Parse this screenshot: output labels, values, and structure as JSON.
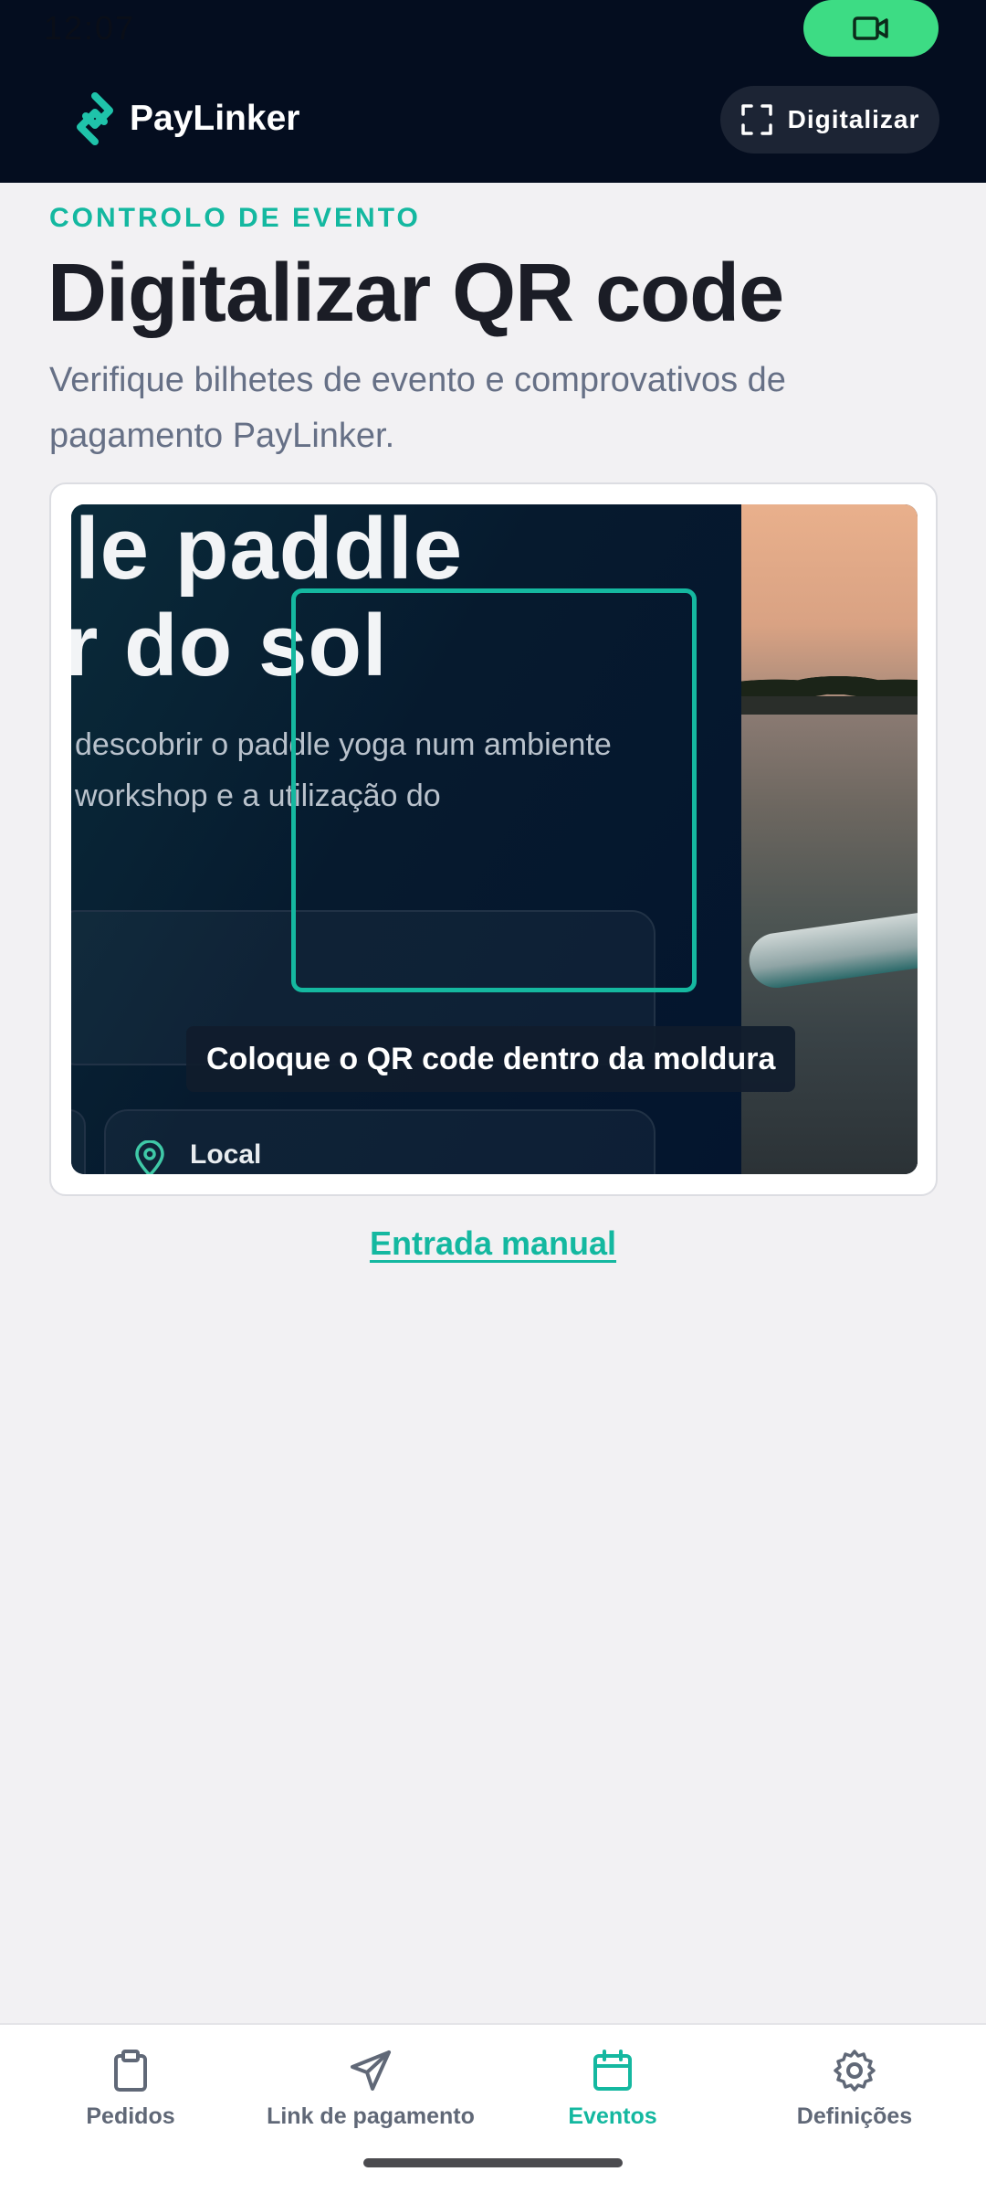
{
  "status_bar": {
    "time": "12:07"
  },
  "header": {
    "brand_name": "PayLinker",
    "scan_button_label": "Digitalizar"
  },
  "page": {
    "eyebrow": "CONTROLO DE EVENTO",
    "title": "Digitalizar QR code",
    "subtitle": "Verifique bilhetes de evento e comprovativos de pagamento PayLinker."
  },
  "scanner": {
    "camera_feed": {
      "headline_line1": "le paddle",
      "headline_line2": "r do sol",
      "body_line1": "descobrir o paddle yoga num ambiente",
      "body_line2": "workshop e a utilização do",
      "location_label": "Local"
    },
    "hint": "Coloque o QR code dentro da moldura"
  },
  "manual_entry_label": "Entrada manual",
  "bottom_nav": {
    "items": [
      {
        "label": "Pedidos",
        "icon": "clipboard-icon",
        "active": false
      },
      {
        "label": "Link de pagamento",
        "icon": "send-icon",
        "active": false
      },
      {
        "label": "Eventos",
        "icon": "calendar-icon",
        "active": true
      },
      {
        "label": "Definições",
        "icon": "gear-icon",
        "active": false
      }
    ]
  },
  "colors": {
    "accent": "#14b8a0",
    "header_bg": "#040d1f",
    "recording_pill": "#3ddc84",
    "page_bg": "#f2f1f3"
  }
}
